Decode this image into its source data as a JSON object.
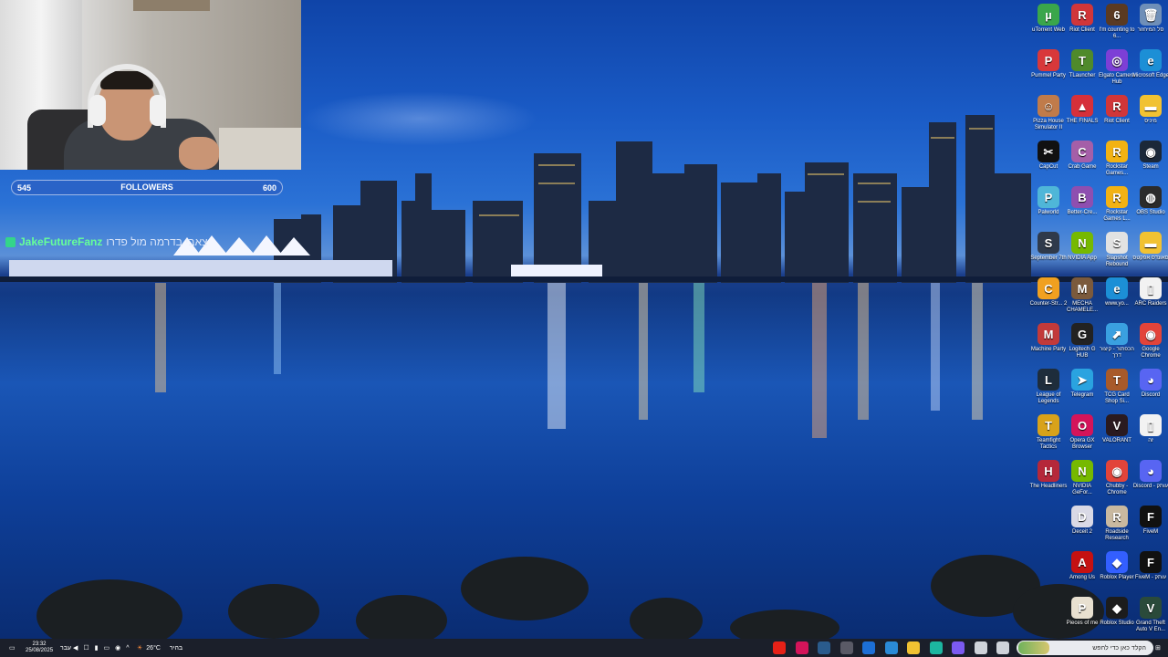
{
  "stream_overlay": {
    "followers_current": "545",
    "followers_label": "FOLLOWERS",
    "followers_goal": "600",
    "chat_user": "JakeFutureFanz",
    "chat_message": "צאבי בדרמה מול פדרו"
  },
  "desktop_icons": [
    {
      "label": "uTorrent Web",
      "icon": "utorrent-icon",
      "color": "#3aa64b",
      "glyph": "µ",
      "col": 0,
      "row": 0
    },
    {
      "label": "Riot Client",
      "icon": "riot-icon",
      "color": "#d13639",
      "glyph": "R",
      "col": 1,
      "row": 0
    },
    {
      "label": "I'm counting to 6...",
      "icon": "game-icon",
      "color": "#5a3a22",
      "glyph": "6",
      "col": 2,
      "row": 0
    },
    {
      "label": "סל המיחזור",
      "icon": "recycle-bin-icon",
      "color": "#6f8fb8",
      "glyph": "🗑",
      "col": 3,
      "row": 0
    },
    {
      "label": "Pummel Party",
      "icon": "pummel-party-icon",
      "color": "#d8383a",
      "glyph": "P",
      "col": 0,
      "row": 1
    },
    {
      "label": "TLauncher",
      "icon": "tlauncher-icon",
      "color": "#4f8a2b",
      "glyph": "T",
      "col": 1,
      "row": 1
    },
    {
      "label": "Elgato Camera Hub",
      "icon": "elgato-icon",
      "color": "#7d3fd6",
      "glyph": "◎",
      "col": 2,
      "row": 1
    },
    {
      "label": "Microsoft Edge",
      "icon": "edge-icon",
      "color": "#1c8fd6",
      "glyph": "e",
      "col": 3,
      "row": 1
    },
    {
      "label": "Pizza House Simulator II",
      "icon": "pizza-icon",
      "color": "#c07b4a",
      "glyph": "☺",
      "col": 0,
      "row": 2
    },
    {
      "label": "THE FINALS",
      "icon": "the-finals-icon",
      "color": "#d6303a",
      "glyph": "▲",
      "col": 1,
      "row": 2
    },
    {
      "label": "Riot Client",
      "icon": "riot-icon",
      "color": "#d13639",
      "glyph": "R",
      "col": 2,
      "row": 2
    },
    {
      "label": "מיניס",
      "icon": "folder-icon",
      "color": "#f1c232",
      "glyph": "▬",
      "col": 3,
      "row": 2
    },
    {
      "label": "CapCut",
      "icon": "capcut-icon",
      "color": "#111111",
      "glyph": "✂",
      "col": 0,
      "row": 3
    },
    {
      "label": "Crab Game",
      "icon": "crab-game-icon",
      "color": "#a55fa8",
      "glyph": "C",
      "col": 1,
      "row": 3
    },
    {
      "label": "Rockstar Games...",
      "icon": "rockstar-icon",
      "color": "#f2b213",
      "glyph": "R",
      "col": 2,
      "row": 3
    },
    {
      "label": "Steam",
      "icon": "steam-icon",
      "color": "#1b2838",
      "glyph": "◉",
      "col": 3,
      "row": 3
    },
    {
      "label": "Palworld",
      "icon": "palworld-icon",
      "color": "#4fb6d8",
      "glyph": "P",
      "col": 0,
      "row": 4
    },
    {
      "label": "Better-Cre...",
      "icon": "better-crewlink-icon",
      "color": "#8e4fb0",
      "glyph": "B",
      "col": 1,
      "row": 4
    },
    {
      "label": "Rockstar Games L...",
      "icon": "rockstar-icon",
      "color": "#f2b213",
      "glyph": "R",
      "col": 2,
      "row": 4
    },
    {
      "label": "OBS Studio",
      "icon": "obs-icon",
      "color": "#2b2b2b",
      "glyph": "◍",
      "col": 3,
      "row": 4
    },
    {
      "label": "September 7th",
      "icon": "app-icon",
      "color": "#2f3a4b",
      "glyph": "S",
      "col": 0,
      "row": 5
    },
    {
      "label": "NVIDIA App",
      "icon": "nvidia-icon",
      "color": "#76b900",
      "glyph": "N",
      "col": 1,
      "row": 5
    },
    {
      "label": "Slapshot Rebound",
      "icon": "slapshot-icon",
      "color": "#e2e2e2",
      "glyph": "S",
      "col": 2,
      "row": 5
    },
    {
      "label": "סאונדס אפקטס",
      "icon": "folder-icon",
      "color": "#f1c232",
      "glyph": "▬",
      "col": 3,
      "row": 5
    },
    {
      "label": "Counter-Str... 2",
      "icon": "counter-strike-icon",
      "color": "#f0a020",
      "glyph": "C",
      "col": 0,
      "row": 6
    },
    {
      "label": "MECHA CHAMELE...",
      "icon": "mecha-icon",
      "color": "#7b5a3c",
      "glyph": "M",
      "col": 1,
      "row": 6
    },
    {
      "label": "www.yo...",
      "icon": "edge-icon",
      "color": "#1c8fd6",
      "glyph": "e",
      "col": 2,
      "row": 6
    },
    {
      "label": "ARC Raiders",
      "icon": "file-icon",
      "color": "#f2f2f2",
      "glyph": "▯",
      "col": 3,
      "row": 6
    },
    {
      "label": "Machine Party",
      "icon": "machine-party-icon",
      "color": "#c23a3a",
      "glyph": "M",
      "col": 0,
      "row": 7
    },
    {
      "label": "Logitech G HUB",
      "icon": "logitech-icon",
      "color": "#222222",
      "glyph": "G",
      "col": 1,
      "row": 7
    },
    {
      "label": "הכפתור - קיצור דרך",
      "icon": "shortcut-icon",
      "color": "#3aa0e0",
      "glyph": "⬈",
      "col": 2,
      "row": 7
    },
    {
      "label": "Google Chrome",
      "icon": "chrome-icon",
      "color": "#e2443a",
      "glyph": "◉",
      "col": 3,
      "row": 7
    },
    {
      "label": "League of Legends",
      "icon": "league-icon",
      "color": "#1e2d3c",
      "glyph": "L",
      "col": 0,
      "row": 8
    },
    {
      "label": "Telegram",
      "icon": "telegram-icon",
      "color": "#2aa3e0",
      "glyph": "➤",
      "col": 1,
      "row": 8
    },
    {
      "label": "TCG Card Shop Si...",
      "icon": "tcg-icon",
      "color": "#a85a2a",
      "glyph": "T",
      "col": 2,
      "row": 8
    },
    {
      "label": "Discord",
      "icon": "discord-icon",
      "color": "#5865f2",
      "glyph": "◕",
      "col": 3,
      "row": 8
    },
    {
      "label": "Teamfight Tactics",
      "icon": "tft-icon",
      "color": "#d8a21a",
      "glyph": "T",
      "col": 0,
      "row": 9
    },
    {
      "label": "Opera GX Browser",
      "icon": "opera-gx-icon",
      "color": "#d4145a",
      "glyph": "O",
      "col": 1,
      "row": 9
    },
    {
      "label": "VALORANT",
      "icon": "valorant-icon",
      "color": "#2a1a1f",
      "glyph": "V",
      "col": 2,
      "row": 9
    },
    {
      "label": "זה",
      "icon": "file-icon",
      "color": "#f2f2f2",
      "glyph": "▯",
      "col": 3,
      "row": 9
    },
    {
      "label": "The Headliners",
      "icon": "headliners-icon",
      "color": "#b5283a",
      "glyph": "H",
      "col": 0,
      "row": 10
    },
    {
      "label": "NVIDIA GeFor...",
      "icon": "nvidia-icon",
      "color": "#76b900",
      "glyph": "N",
      "col": 1,
      "row": 10
    },
    {
      "label": "Chubby - Chrome",
      "icon": "chrome-icon",
      "color": "#e2443a",
      "glyph": "◉",
      "col": 2,
      "row": 10
    },
    {
      "label": "Discord - עותק",
      "icon": "discord-icon",
      "color": "#5865f2",
      "glyph": "◕",
      "col": 3,
      "row": 10
    },
    {
      "label": "Deceit 2",
      "icon": "deceit-icon",
      "color": "#d9d9e6",
      "glyph": "D",
      "col": 1,
      "row": 11
    },
    {
      "label": "Roadside Research",
      "icon": "roadside-icon",
      "color": "#c9b9a0",
      "glyph": "R",
      "col": 2,
      "row": 11
    },
    {
      "label": "FiveM",
      "icon": "fivem-icon",
      "color": "#111111",
      "glyph": "F",
      "col": 3,
      "row": 11
    },
    {
      "label": "Among Us",
      "icon": "among-us-icon",
      "color": "#c51111",
      "glyph": "A",
      "col": 1,
      "row": 12
    },
    {
      "label": "Roblox Player",
      "icon": "roblox-icon",
      "color": "#335fff",
      "glyph": "◆",
      "col": 2,
      "row": 12
    },
    {
      "label": "FiveM - עותק",
      "icon": "fivem-icon",
      "color": "#111111",
      "glyph": "F",
      "col": 3,
      "row": 12
    },
    {
      "label": "Pieces of me",
      "icon": "pieces-icon",
      "color": "#e8e0d0",
      "glyph": "P",
      "col": 1,
      "row": 13
    },
    {
      "label": "Roblox Studio",
      "icon": "roblox-studio-icon",
      "color": "#1c1c1c",
      "glyph": "◆",
      "col": 2,
      "row": 13
    },
    {
      "label": "Grand Theft Auto V En...",
      "icon": "gta-icon",
      "color": "#2a4a3a",
      "glyph": "V",
      "col": 3,
      "row": 13
    }
  ],
  "taskbar": {
    "time": "23:32",
    "date": "25/08/2025",
    "lang": "עבר",
    "weather_temp": "26°C",
    "weather_text": "בהיר",
    "search_placeholder": "הקלד כאן כדי לחפש",
    "pinned": [
      {
        "icon": "youtube-icon",
        "color": "#e62117"
      },
      {
        "icon": "opera-gx-icon",
        "color": "#d4145a"
      },
      {
        "icon": "steam-icon",
        "color": "#2a5b8c"
      },
      {
        "icon": "obs-icon",
        "color": "#5a5a66"
      },
      {
        "icon": "outlook-icon",
        "color": "#1c6fd6"
      },
      {
        "icon": "store-icon",
        "color": "#2a8ad6"
      },
      {
        "icon": "file-explorer-icon",
        "color": "#f1c232"
      },
      {
        "icon": "edge-icon",
        "color": "#1cb6a0"
      },
      {
        "icon": "copilot-icon",
        "color": "#7b5af0"
      },
      {
        "icon": "task-view-icon",
        "color": "#cfd3da"
      },
      {
        "icon": "cortana-icon",
        "color": "#cfd3da"
      }
    ]
  }
}
